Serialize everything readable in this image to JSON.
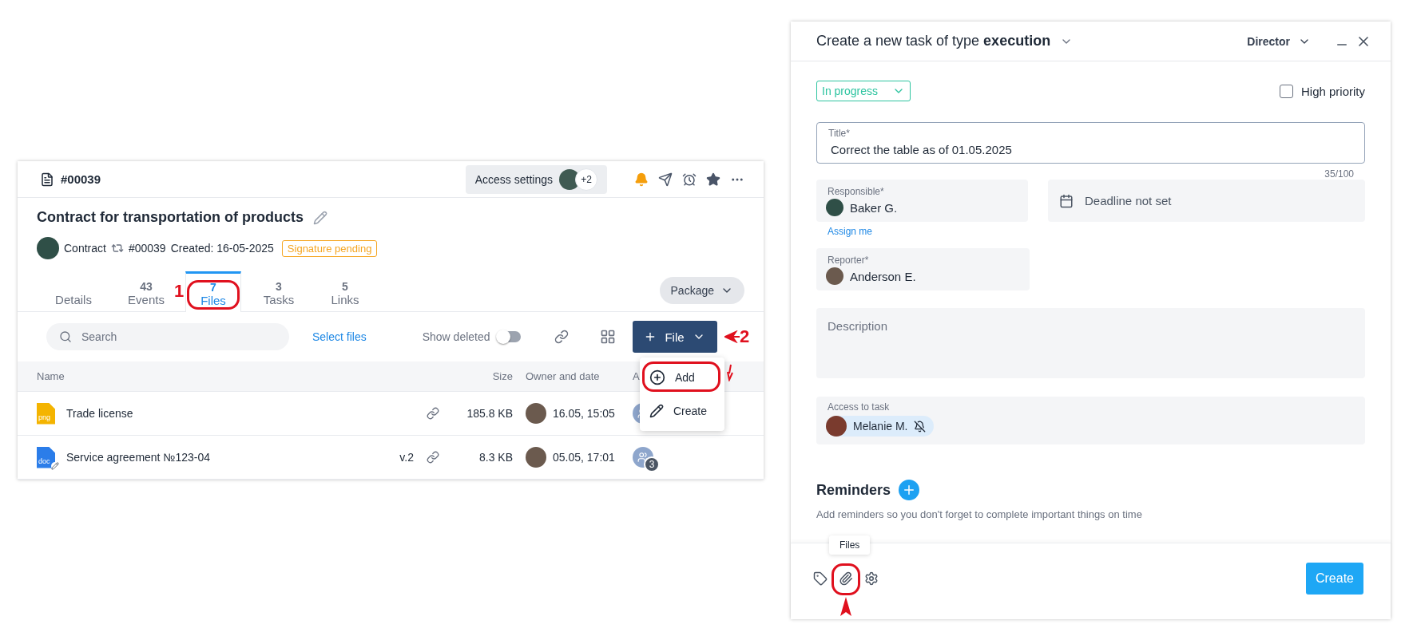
{
  "card": {
    "number": "#00039",
    "access_settings": "Access settings",
    "access_extra": "+2",
    "title": "Contract for transportation of products",
    "meta": {
      "type": "Contract",
      "number": "#00039",
      "created": "Created: 16-05-2025",
      "status": "Signature pending"
    },
    "tabs": [
      {
        "label": "Details",
        "selected": false
      },
      {
        "count": "43",
        "label": "Events",
        "selected": false
      },
      {
        "count": "7",
        "label": "Files",
        "selected": true
      },
      {
        "count": "3",
        "label": "Tasks",
        "selected": false
      },
      {
        "count": "5",
        "label": "Links",
        "selected": false
      }
    ],
    "package": "Package",
    "toolbar": {
      "search_placeholder": "Search",
      "select_files": "Select files",
      "show_deleted": {
        "label": "Show deleted",
        "on": false
      },
      "file_button": "File"
    },
    "file_menu": [
      {
        "kind": "add",
        "label": "Add"
      },
      {
        "kind": "create",
        "label": "Create"
      }
    ],
    "table": {
      "columns": [
        "Name",
        "Size",
        "Owner and date",
        "A"
      ],
      "rows": [
        {
          "kind": "image",
          "type": "png",
          "name": "Trade license",
          "size": "185.8 KB",
          "date": "16.05, 15:05",
          "edited": false
        },
        {
          "kind": "document",
          "type": "doc",
          "name": "Service agreement №123-04",
          "version": "v.2",
          "size": "8.3 KB",
          "date": "05.05, 17:01",
          "access_count": "3",
          "edited": true
        }
      ]
    },
    "annotations": [
      "1",
      "2"
    ]
  },
  "task_dialog": {
    "title": "Create a new task of type **execution**",
    "role": "Director",
    "status": "In progress",
    "high_priority": {
      "label": "High priority",
      "checked": false
    },
    "title_field": {
      "label": "Title*",
      "value": "Correct the table as of 01.05.2025",
      "counter": "35/100"
    },
    "responsible": {
      "label": "Responsible*",
      "name": "Baker G."
    },
    "deadline": "Deadline not set",
    "assign_me": "Assign me",
    "reporter": {
      "label": "Reporter*",
      "name": "Anderson E."
    },
    "description": {
      "placeholder": "Description"
    },
    "access": {
      "label": "Access to task",
      "people": [
        {
          "name": "Melanie M."
        }
      ]
    },
    "reminders": {
      "title": "Reminders",
      "hint": "Add reminders so you don't forget to complete important things on time"
    },
    "tooltip": "Files",
    "create": "Create"
  }
}
